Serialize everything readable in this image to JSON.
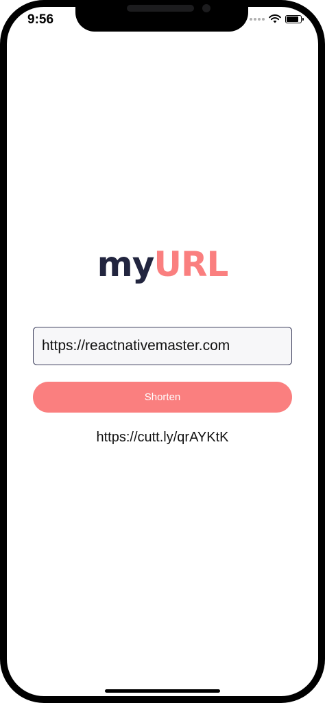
{
  "status_bar": {
    "time": "9:56",
    "battery_level": 0.9
  },
  "app": {
    "logo_part1": "my",
    "logo_part2": "URL",
    "colors": {
      "dark": "#22253f",
      "accent": "#fa7f7f"
    }
  },
  "form": {
    "url_value": "https://reactnativemaster.com",
    "shorten_label": "Shorten"
  },
  "result": {
    "short_url": "https://cutt.ly/qrAYKtK"
  },
  "icons": [
    "signal-dots-icon",
    "wifi-icon",
    "battery-icon"
  ]
}
